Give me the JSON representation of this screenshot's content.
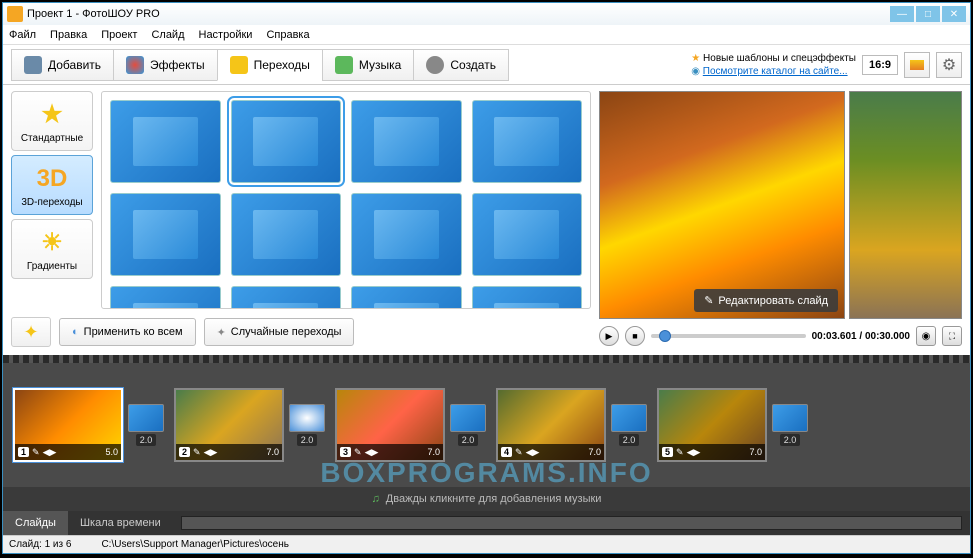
{
  "title": "Проект 1 - ФотоШОУ PRO",
  "menu": [
    "Файл",
    "Правка",
    "Проект",
    "Слайд",
    "Настройки",
    "Справка"
  ],
  "tabs": {
    "add": "Добавить",
    "effects": "Эффекты",
    "transitions": "Переходы",
    "music": "Музыка",
    "create": "Создать"
  },
  "promo": {
    "line1": "Новые шаблоны и спецэффекты",
    "line2": "Посмотрите каталог на сайте..."
  },
  "aspect": "16:9",
  "categories": {
    "standard": "Стандартные",
    "threeD": "3D-переходы",
    "gradients": "Градиенты"
  },
  "threeD_label": "3D",
  "actions": {
    "applyAll": "Применить ко всем",
    "random": "Случайные переходы"
  },
  "preview": {
    "editSlide": "Редактировать слайд",
    "time": "00:03.601 / 00:30.000"
  },
  "timeline": {
    "slides": [
      {
        "num": "1",
        "dur": "5.0",
        "trans": "2.0",
        "bg": "linear-gradient(135deg,#8b4513,#ff8c00,#ffd700)"
      },
      {
        "num": "2",
        "dur": "7.0",
        "trans": "2.0",
        "bg": "linear-gradient(135deg,#4a7c4a,#daa520,#8b7355)"
      },
      {
        "num": "3",
        "dur": "7.0",
        "trans": "2.0",
        "bg": "linear-gradient(135deg,#b8860b,#ff6347,#8b4513)"
      },
      {
        "num": "4",
        "dur": "7.0",
        "trans": "2.0",
        "bg": "linear-gradient(135deg,#556b2f,#daa520,#8b4513)"
      },
      {
        "num": "5",
        "dur": "7.0",
        "trans": "2.0",
        "bg": "linear-gradient(135deg,#4a7c4a,#b8860b,#6b4423)"
      }
    ],
    "musicHint": "Дважды кликните для добавления музыки"
  },
  "bottomTabs": {
    "slides": "Слайды",
    "timescale": "Шкала времени"
  },
  "status": {
    "slide": "Слайд: 1 из 6",
    "path": "C:\\Users\\Support Manager\\Pictures\\осень"
  },
  "watermark": "BOXPROGRAMS.INFO",
  "icons": {
    "pencil": "✎",
    "arrows": "◀▶",
    "play": "▶",
    "stop": "■",
    "camera": "📷",
    "full": "⛶",
    "note": "♫",
    "star": "★",
    "wand": "✦",
    "gear": "⚙"
  }
}
